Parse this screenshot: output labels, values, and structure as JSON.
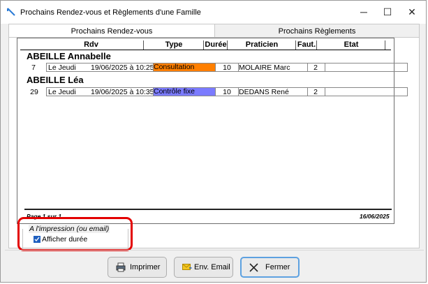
{
  "window": {
    "title": "Prochains Rendez-vous et Règlements d'une Famille",
    "controls": {
      "minimize": "─",
      "maximize": "☐",
      "close": "✕"
    }
  },
  "tabs": [
    {
      "label": "Prochains Rendez-vous",
      "active": true
    },
    {
      "label": "Prochains Règlements",
      "active": false
    }
  ],
  "report": {
    "columns": [
      "Rdv",
      "Type",
      "Durée",
      "Praticien",
      "Faut.",
      "Etat"
    ],
    "groups": [
      {
        "name": "ABEILLE Annabelle",
        "rows": [
          {
            "num": "7",
            "day": "Le Jeudi",
            "date": "19/06/2025 à 10:25",
            "type": "Consultation",
            "type_color": "#ff7f00",
            "duree": "10",
            "praticien": "MOLAIRE Marc",
            "faut": "2",
            "etat": ""
          }
        ]
      },
      {
        "name": "ABEILLE Léa",
        "rows": [
          {
            "num": "29",
            "day": "Le Jeudi",
            "date": "19/06/2025 à 10:35",
            "type": "Contrôle fixe",
            "type_color": "#7b7bff",
            "duree": "10",
            "praticien": "DEDANS René",
            "faut": "2",
            "etat": ""
          }
        ]
      }
    ],
    "footer_left": "Page 1 sur 1",
    "footer_right": "16/06/2025"
  },
  "options": {
    "group_title": "A l'impression (ou email)",
    "afficher_duree_label": "Afficher durée",
    "afficher_duree_checked": true,
    "highlight_color": "#e30000"
  },
  "buttons": {
    "imprimer": {
      "label": "Imprimer",
      "icon": "printer-icon"
    },
    "email": {
      "label": "Env. Email",
      "icon": "envelope-icon"
    },
    "fermer": {
      "label": "Fermer",
      "icon": "close-icon"
    }
  }
}
